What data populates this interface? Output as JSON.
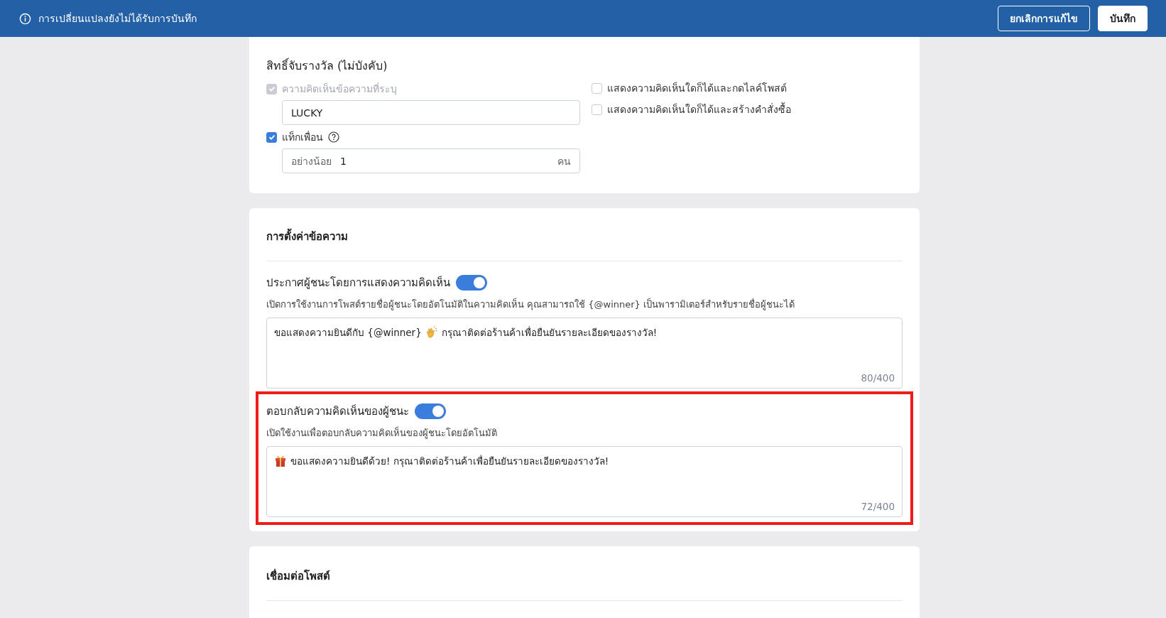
{
  "top_bar": {
    "message": "การเปลี่ยนแปลงยังไม่ได้รับการบันทึก",
    "buttons": [
      {
        "label": "ยกเลิกการแก้ไข",
        "kind": "outline"
      },
      {
        "label": "บันทึก",
        "kind": "solid"
      }
    ]
  },
  "eligibility": {
    "title": "สิทธิ์จับรางวัล (ไม่บังคับ)",
    "left": [
      {
        "label": "ความคิดเห็นข้อความที่ระบุ",
        "checked": true,
        "disabled": true,
        "help": false,
        "field": {
          "value": "LUCKY"
        }
      },
      {
        "label": "แท็กเพื่อน",
        "checked": true,
        "disabled": false,
        "help": true,
        "field": {
          "prefix": "อย่างน้อย",
          "value": "1",
          "suffix": "คน"
        }
      }
    ],
    "right": [
      {
        "label": "แสดงความคิดเห็นใดก็ได้และกดไลค์โพสต์",
        "checked": false
      },
      {
        "label": "แสดงความคิดเห็นใดก็ได้และสร้างคำสั่งซื้อ",
        "checked": false
      }
    ]
  },
  "message_settings": {
    "title": "การตั้งค่าข้อความ",
    "items": [
      {
        "label": "ประกาศผู้ชนะโดยการแสดงความคิดเห็น",
        "on": true,
        "highlighted": false,
        "description": "เปิดการใช้งานการโพสต์รายชื่อผู้ชนะโดยอัตโนมัติในความคิดเห็น คุณสามารถใช้ {@winner} เป็นพารามิเตอร์สำหรับรายชื่อผู้ชนะได้",
        "value": [
          {
            "kind": "text",
            "text": "ขอแสดงความยินดีกับ {@winner}"
          },
          {
            "kind": "clap"
          },
          {
            "kind": "text",
            "text": "กรุณาติดต่อร้านค้าเพื่อยืนยันรายละเอียดของรางวัล!"
          }
        ],
        "count": "80/400"
      },
      {
        "label": "ตอบกลับความคิดเห็นของผู้ชนะ",
        "on": true,
        "highlighted": true,
        "description": "เปิดใช้งานเพื่อตอบกลับความคิดเห็นของผู้ชนะโดยอัตโนมัติ",
        "value": [
          {
            "kind": "gift"
          },
          {
            "kind": "text",
            "text": "ขอแสดงความยินดีด้วย! กรุณาติดต่อร้านค้าเพื่อยืนยันรายละเอียดของรางวัล!"
          }
        ],
        "count": "72/400"
      }
    ]
  },
  "connect_post": {
    "title": "เชื่อมต่อโพสต์"
  }
}
